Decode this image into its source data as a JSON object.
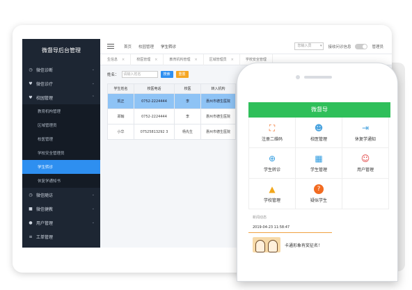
{
  "admin": {
    "title": "微督导后台管理",
    "sidebar": {
      "items": [
        {
          "label": "微信诊断",
          "icon": "clock-icon",
          "chevron": "⌄"
        },
        {
          "label": "微信诊疗",
          "icon": "heart-icon",
          "chevron": "⌄"
        },
        {
          "label": "校园管理",
          "icon": "heart-icon",
          "chevron": "⌃"
        }
      ],
      "subitems": [
        {
          "label": "教育机构管理"
        },
        {
          "label": "区域管理员"
        },
        {
          "label": "校医管理"
        },
        {
          "label": "学校安全管理员"
        },
        {
          "label": "学生转诊",
          "active": true
        },
        {
          "label": "休复学通知书"
        }
      ],
      "items2": [
        {
          "label": "微信随访",
          "icon": "clock-icon",
          "chevron": "⌄"
        },
        {
          "label": "微信健教",
          "icon": "book-icon",
          "chevron": "⌄"
        },
        {
          "label": "用户管理",
          "icon": "user-icon",
          "chevron": "⌄"
        },
        {
          "label": "工单管理",
          "icon": "list-icon",
          "chevron": ""
        }
      ]
    },
    "breadcrumb": {
      "home": "首页",
      "section": "校园管理",
      "current": "学生转诊"
    },
    "topright": {
      "select_placeholder": "您输入员",
      "notice_label": "接收问诊信息",
      "user": "管理员"
    },
    "tabs": [
      {
        "label": "生信息"
      },
      {
        "label": "校医管理"
      },
      {
        "label": "教育机构管理"
      },
      {
        "label": "区域管理员"
      },
      {
        "label": "学校安全管理"
      }
    ],
    "search": {
      "label": "姓名：",
      "placeholder": "请输入姓名",
      "search_btn": "搜索",
      "reset_btn": "重置"
    },
    "table": {
      "headers": [
        "学生姓名",
        "校医电话",
        "校医",
        "转入机构"
      ],
      "rows": [
        [
          "凯正",
          "0752-2224444",
          "李",
          "惠州市德生医院"
        ],
        [
          "郑翰",
          "0752-2224444",
          "李",
          "惠州市德生医院"
        ],
        [
          "小华",
          "07525813292 3",
          "杨先生",
          "惠州市德生医院"
        ]
      ]
    }
  },
  "mobile": {
    "appbar_title": "微督导",
    "grid": [
      {
        "label": "注册二维码",
        "icon": "scan-icon",
        "color": "#f26b21"
      },
      {
        "label": "校医管理",
        "icon": "doctor-group-icon",
        "color": "#4aa3df"
      },
      {
        "label": "休复学通知",
        "icon": "login-icon",
        "color": "#4aa3df"
      },
      {
        "label": "学生转诊",
        "icon": "transfer-icon",
        "color": "#2e9be0"
      },
      {
        "label": "学生管理",
        "icon": "calendar-icon",
        "color": "#2e9be0"
      },
      {
        "label": "用户管理",
        "icon": "users-icon",
        "color": "#e04040"
      },
      {
        "label": "学校管理",
        "icon": "graduation-icon",
        "color": "#f2a71b"
      },
      {
        "label": "疑似学生",
        "icon": "question-icon",
        "color": "#f26b21"
      }
    ],
    "news": {
      "heading": "新闻动态",
      "time": "2019-04-23 11:58:47",
      "text": "卡通形象有奖征名！"
    }
  }
}
